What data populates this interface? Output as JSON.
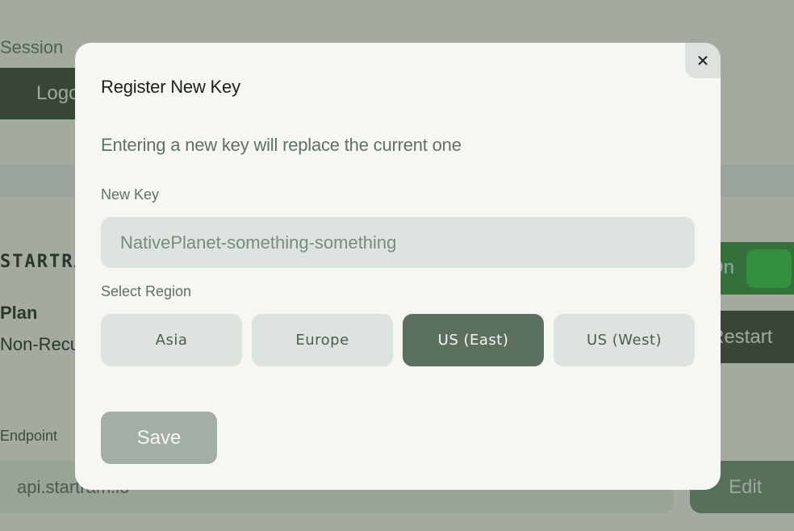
{
  "background": {
    "session_label": "Session",
    "logout_label": "Logout",
    "logo_text": "STARTRAM",
    "plan_label": "Plan",
    "plan_value": "Non-Recurring",
    "toggle_label": "On",
    "restart_label": "Restart",
    "endpoint_label": "Endpoint",
    "endpoint_value": "api.startram.io",
    "edit_label": "Edit"
  },
  "modal": {
    "title": "Register New Key",
    "description": "Entering a new key will replace the current one",
    "key_label": "New Key",
    "key_placeholder": "NativePlanet-something-something",
    "region_label": "Select Region",
    "regions": [
      {
        "label": "Asia",
        "selected": false
      },
      {
        "label": "Europe",
        "selected": false
      },
      {
        "label": "US (East)",
        "selected": true
      },
      {
        "label": "US (West)",
        "selected": false
      }
    ],
    "save_label": "Save",
    "close_icon": "close-icon"
  },
  "colors": {
    "accent": "#5c7060",
    "toggle_on": "#2dc540",
    "dark_button": "#334033"
  }
}
